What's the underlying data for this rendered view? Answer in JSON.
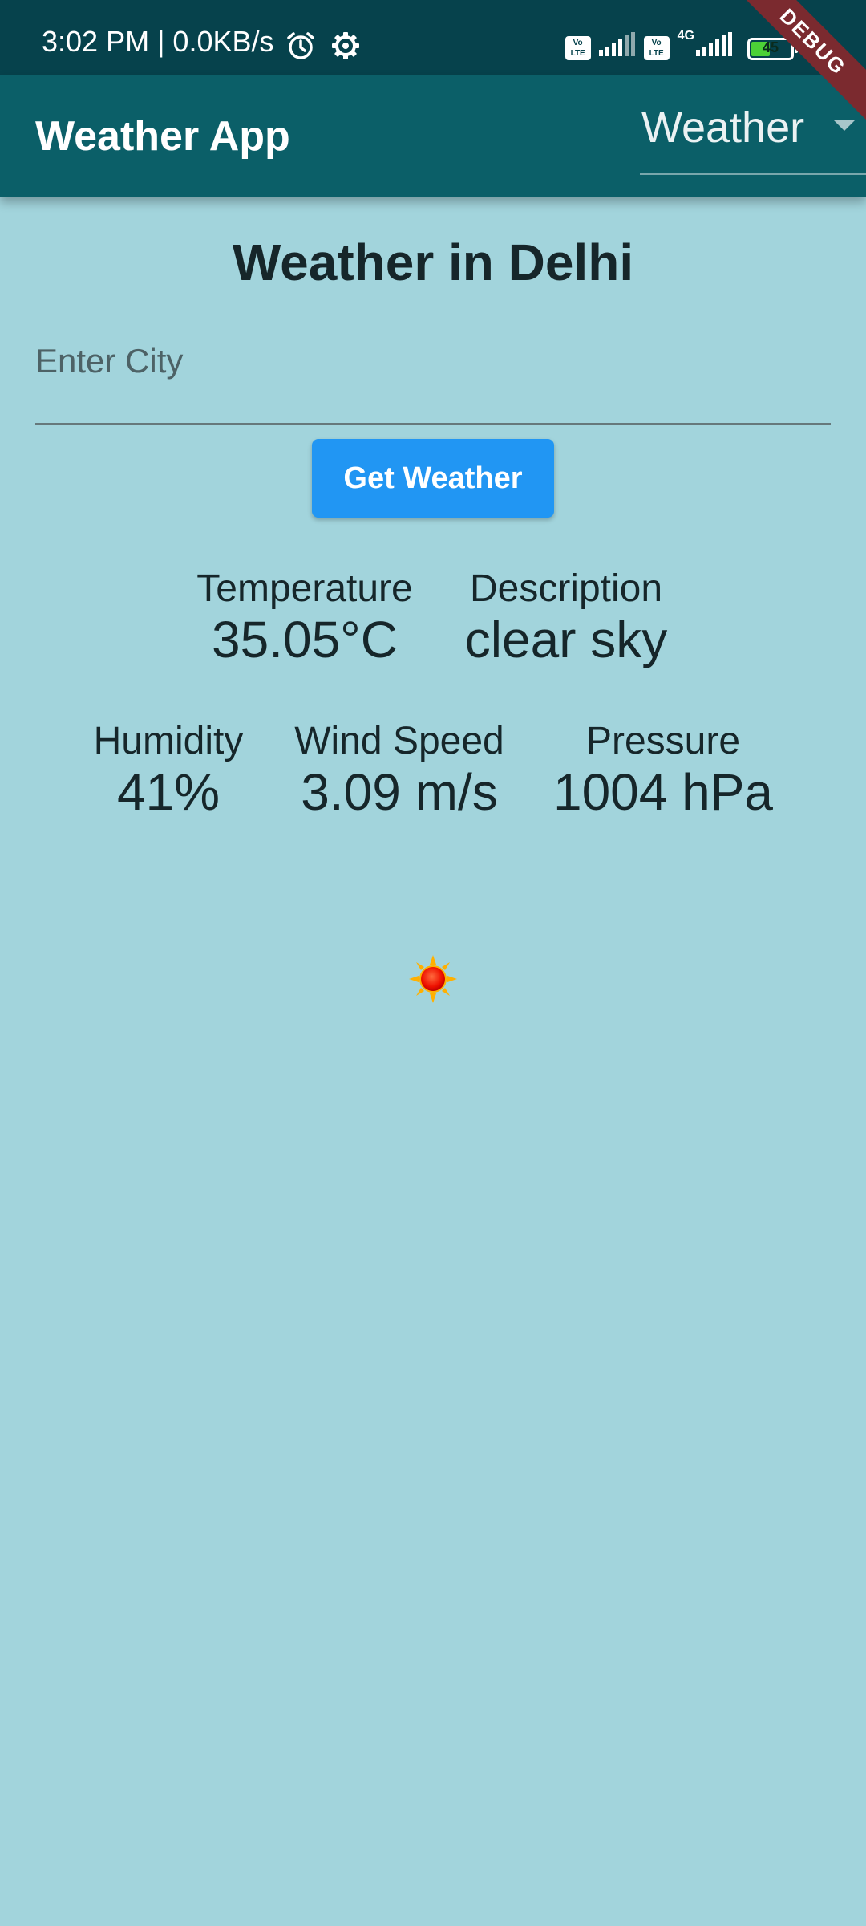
{
  "status_bar": {
    "time": "3:02 PM | 0.0KB/s",
    "icons_left": [
      "alarm-icon",
      "settings-icon"
    ],
    "volte_label": "Vo LTE",
    "network_label": "4G",
    "battery_level": "45"
  },
  "debug_banner": "DEBUG",
  "app_bar": {
    "title": "Weather App",
    "dropdown_value": "Weather"
  },
  "main": {
    "heading": "Weather in Delhi",
    "city_input": {
      "placeholder": "Enter City",
      "value": ""
    },
    "get_weather_label": "Get Weather",
    "stats": {
      "temperature": {
        "label": "Temperature",
        "value": "35.05°C"
      },
      "description": {
        "label": "Description",
        "value": "clear sky"
      },
      "humidity": {
        "label": "Humidity",
        "value": "41%"
      },
      "wind_speed": {
        "label": "Wind Speed",
        "value": "3.09 m/s"
      },
      "pressure": {
        "label": "Pressure",
        "value": "1004 hPa"
      }
    },
    "weather_icon": "sun-icon"
  },
  "colors": {
    "background": "#a2d4dc",
    "status_bar": "#06424c",
    "app_bar": "#0b5f68",
    "button": "#2196f3",
    "debug_banner": "#7b2a2f"
  }
}
